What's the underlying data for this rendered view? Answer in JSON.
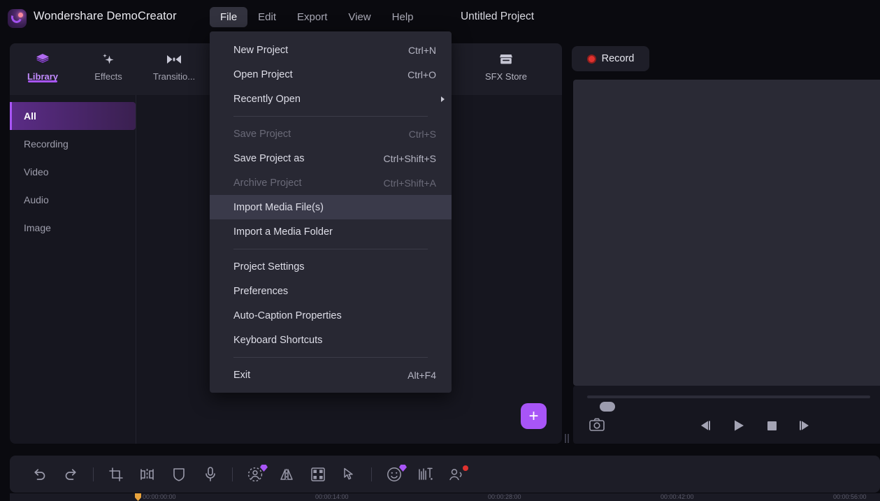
{
  "window": {
    "app_name": "Wondershare DemoCreator",
    "project_title": "Untitled Project",
    "logo_icon": "democreator-logo-icon"
  },
  "menubar": {
    "items": [
      {
        "label": "File",
        "active": true
      },
      {
        "label": "Edit",
        "active": false
      },
      {
        "label": "Export",
        "active": false
      },
      {
        "label": "View",
        "active": false
      },
      {
        "label": "Help",
        "active": false
      }
    ]
  },
  "file_menu": {
    "groups": [
      {
        "items": [
          {
            "label": "New Project",
            "accel": "Ctrl+N",
            "disabled": false,
            "submenu": false,
            "highlight": false
          },
          {
            "label": "Open Project",
            "accel": "Ctrl+O",
            "disabled": false,
            "submenu": false,
            "highlight": false
          },
          {
            "label": "Recently Open",
            "accel": "",
            "disabled": false,
            "submenu": true,
            "highlight": false
          }
        ]
      },
      {
        "items": [
          {
            "label": "Save Project",
            "accel": "Ctrl+S",
            "disabled": true,
            "submenu": false,
            "highlight": false
          },
          {
            "label": "Save Project as",
            "accel": "Ctrl+Shift+S",
            "disabled": false,
            "submenu": false,
            "highlight": false
          },
          {
            "label": "Archive Project",
            "accel": "Ctrl+Shift+A",
            "disabled": true,
            "submenu": false,
            "highlight": false
          },
          {
            "label": "Import Media File(s)",
            "accel": "",
            "disabled": false,
            "submenu": false,
            "highlight": true
          },
          {
            "label": "Import a Media Folder",
            "accel": "",
            "disabled": false,
            "submenu": false,
            "highlight": false
          }
        ]
      },
      {
        "items": [
          {
            "label": "Project Settings",
            "accel": "",
            "disabled": false,
            "submenu": false,
            "highlight": false
          },
          {
            "label": "Preferences",
            "accel": "",
            "disabled": false,
            "submenu": false,
            "highlight": false
          },
          {
            "label": "Auto-Caption Properties",
            "accel": "",
            "disabled": false,
            "submenu": false,
            "highlight": false
          },
          {
            "label": "Keyboard Shortcuts",
            "accel": "",
            "disabled": false,
            "submenu": false,
            "highlight": false
          }
        ]
      },
      {
        "items": [
          {
            "label": "Exit",
            "accel": "Alt+F4",
            "disabled": false,
            "submenu": false,
            "highlight": false
          }
        ]
      }
    ]
  },
  "library": {
    "tabs": [
      {
        "label": "Library",
        "icon": "layers-icon",
        "active": true
      },
      {
        "label": "Effects",
        "icon": "sparkle-icon",
        "active": false
      },
      {
        "label": "Transitio...",
        "icon": "transition-icon",
        "active": false
      }
    ],
    "sfx_tab": {
      "label": "SFX Store",
      "icon": "store-icon"
    },
    "categories": [
      {
        "label": "All",
        "active": true
      },
      {
        "label": "Recording",
        "active": false
      },
      {
        "label": "Video",
        "active": false
      },
      {
        "label": "Audio",
        "active": false
      },
      {
        "label": "Image",
        "active": false
      }
    ],
    "add_button": {
      "icon": "plus-icon",
      "label": "+"
    }
  },
  "preview": {
    "record_button": {
      "label": "Record",
      "icon": "record-dot-icon",
      "color": "#e0322f"
    },
    "snapshot_button": {
      "icon": "camera-icon"
    },
    "transport": [
      {
        "name": "prev-frame",
        "icon": "step-backward-icon"
      },
      {
        "name": "play",
        "icon": "play-icon"
      },
      {
        "name": "stop",
        "icon": "stop-icon"
      },
      {
        "name": "next-frame",
        "icon": "step-forward-icon"
      }
    ]
  },
  "toolbar": {
    "tools": [
      {
        "name": "undo",
        "icon": "undo-icon",
        "badge": "none"
      },
      {
        "name": "redo",
        "icon": "redo-icon",
        "badge": "none"
      },
      {
        "name": "divider-1",
        "icon": "divider",
        "badge": "none"
      },
      {
        "name": "crop",
        "icon": "crop-icon",
        "badge": "none"
      },
      {
        "name": "split",
        "icon": "split-icon",
        "badge": "none"
      },
      {
        "name": "mask",
        "icon": "shield-mask-icon",
        "badge": "none"
      },
      {
        "name": "voiceover",
        "icon": "microphone-icon",
        "badge": "none"
      },
      {
        "name": "divider-2",
        "icon": "divider",
        "badge": "none"
      },
      {
        "name": "ai-avatar",
        "icon": "ai-portrait-icon",
        "badge": "gem"
      },
      {
        "name": "mirror",
        "icon": "mirror-flip-icon",
        "badge": "none"
      },
      {
        "name": "mosaic",
        "icon": "mosaic-icon",
        "badge": "none"
      },
      {
        "name": "cursor-effects",
        "icon": "cursor-pointer-icon",
        "badge": "none"
      },
      {
        "name": "divider-3",
        "icon": "divider",
        "badge": "none"
      },
      {
        "name": "sticker",
        "icon": "smiley-icon",
        "badge": "gem"
      },
      {
        "name": "auto-caption",
        "icon": "captions-icon",
        "badge": "none"
      },
      {
        "name": "ai-denoise",
        "icon": "speaker-person-icon",
        "badge": "dot"
      }
    ]
  },
  "timeline": {
    "timecodes": [
      "00:00:00:00",
      "00:00:14:00",
      "00:00:28:00",
      "00:00:42:00",
      "00:00:56:00"
    ],
    "playhead_label": "00:00:00:00"
  },
  "colors": {
    "accent_purple": "#a855f7",
    "record_red": "#e0322f",
    "panel_bg": "#16161f",
    "menu_bg": "#282833",
    "playhead_orange": "#e8a33d"
  }
}
